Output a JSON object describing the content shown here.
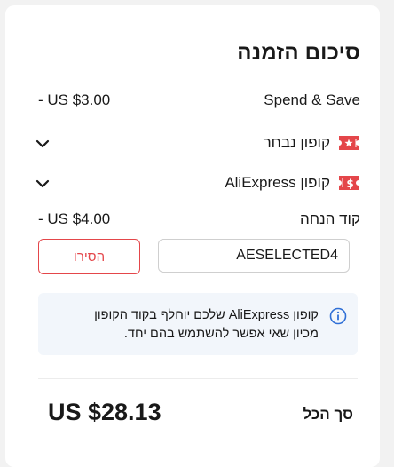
{
  "summary": {
    "title": "סיכום הזמנה",
    "spend_save": {
      "label": "Spend & Save",
      "amount": "- US $3.00"
    },
    "selected_coupon": {
      "label": "קופון נבחר"
    },
    "aliexpress_coupon": {
      "label": "קופון AliExpress"
    },
    "discount_code": {
      "label": "קוד הנחה",
      "amount": "- US $4.00",
      "input_value": "AESELECTED4",
      "remove_label": "הסירו"
    },
    "info": {
      "line1": "קופון AliExpress שלכם יוחלף בקוד הקופון",
      "line2": "מכיון שאי אפשר להשתמש בהם יחד."
    },
    "total": {
      "label": "סך הכל",
      "amount": "US $28.13"
    }
  },
  "colors": {
    "accent": "#e4464a",
    "info_bg": "#f2f6fb",
    "info_icon": "#2f6fd6"
  },
  "icons": {
    "chevron": "chevron-down-icon",
    "coupon_selected": "coupon-star-icon",
    "coupon_aliexpress": "coupon-dollar-icon",
    "info": "info-icon"
  }
}
